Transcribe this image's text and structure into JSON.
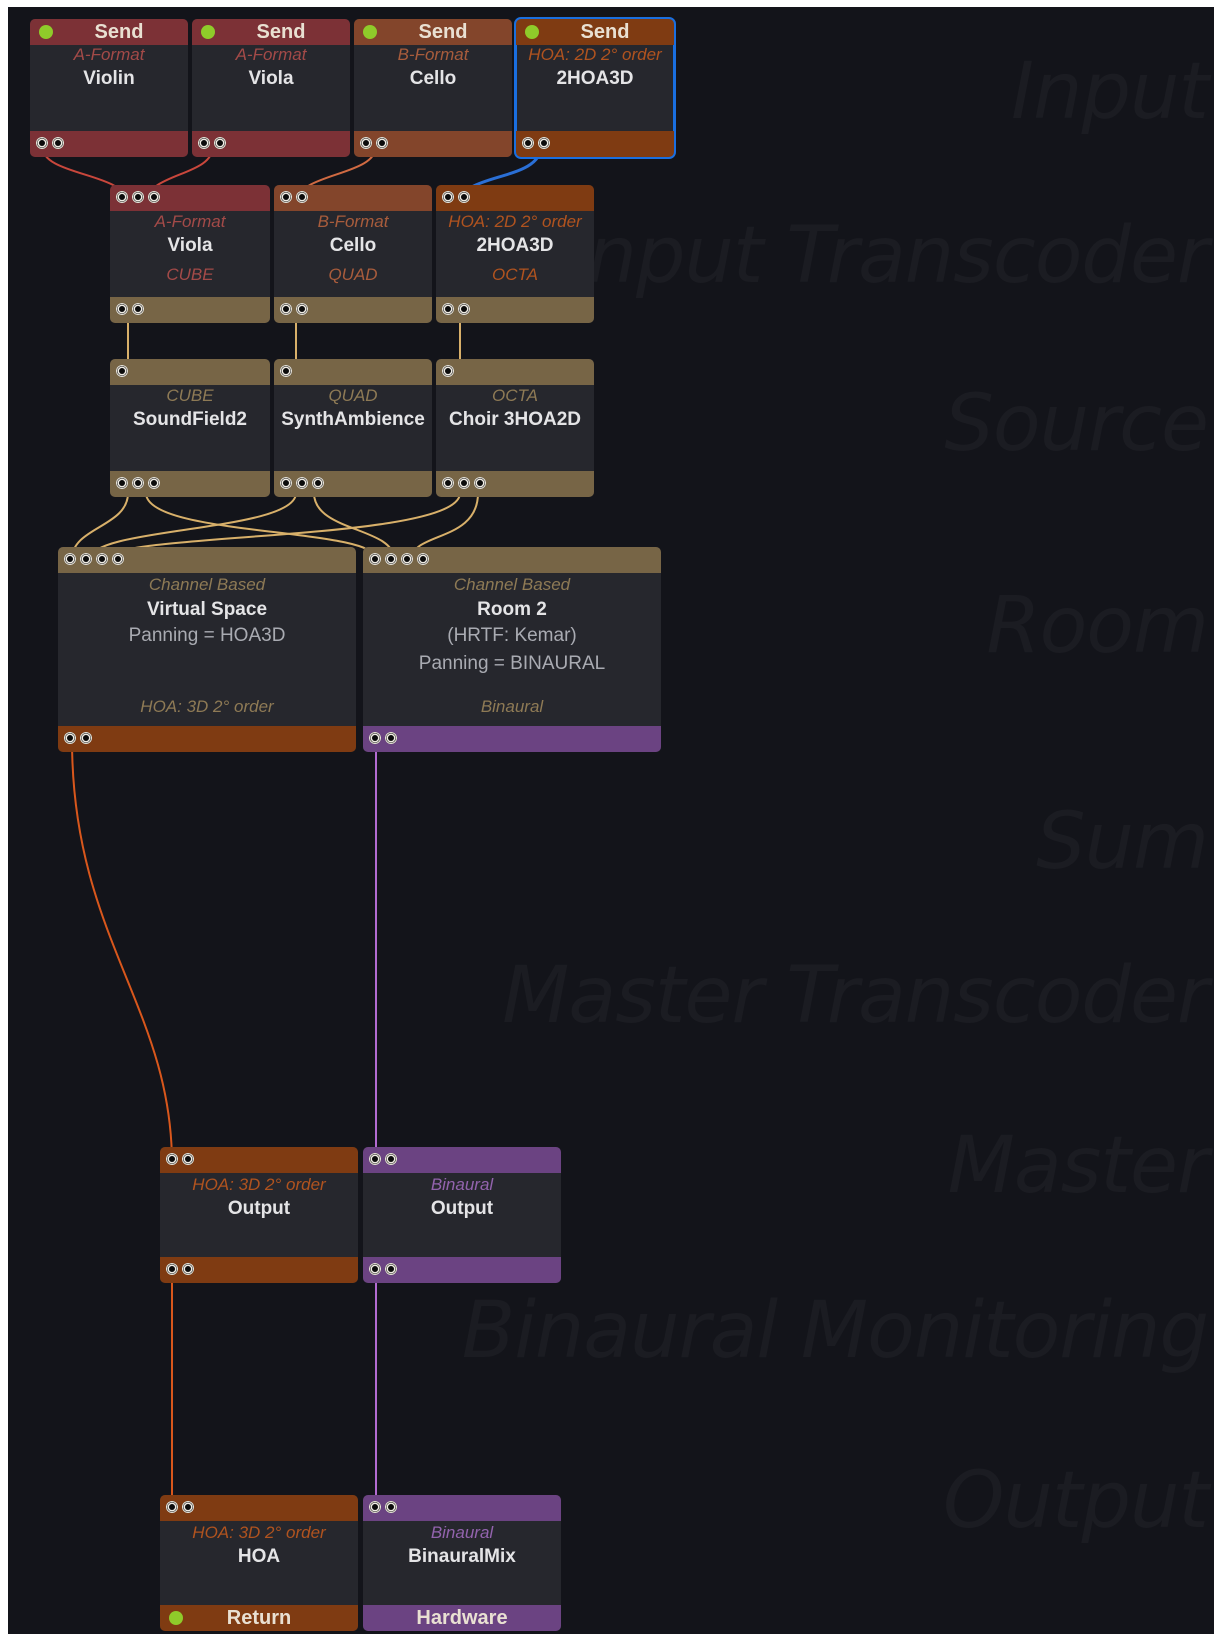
{
  "sections": [
    "Input",
    "Input Transcoder",
    "Source",
    "Room",
    "Sum",
    "Master Transcoder",
    "Master",
    "Binaural Monitoring",
    "Output"
  ],
  "colors": {
    "background": "#13141a",
    "a_format": "#7c3136",
    "b_format": "#83452b",
    "hoa": "#7f3b12",
    "channel": "#776546",
    "binaural": "#6b4382",
    "selection": "#1a6fe0",
    "active_led": "#8fcb2a"
  },
  "icons": [
    "status-led-icon",
    "input-pin-icon",
    "output-pin-icon"
  ],
  "sends": [
    {
      "title": "Send",
      "format": "A-Format",
      "name": "Violin"
    },
    {
      "title": "Send",
      "format": "A-Format",
      "name": "Viola"
    },
    {
      "title": "Send",
      "format": "B-Format",
      "name": "Cello"
    },
    {
      "title": "Send",
      "format": "HOA: 2D 2° order",
      "name": "2HOA3D",
      "selected": true
    }
  ],
  "transcoders": [
    {
      "format": "A-Format",
      "name": "Viola",
      "target": "CUBE"
    },
    {
      "format": "B-Format",
      "name": "Cello",
      "target": "QUAD"
    },
    {
      "format": "HOA: 2D 2° order",
      "name": "2HOA3D",
      "target": "OCTA"
    }
  ],
  "sources": [
    {
      "format": "CUBE",
      "name": "SoundField2"
    },
    {
      "format": "QUAD",
      "name": "SynthAmbience"
    },
    {
      "format": "OCTA",
      "name": "Choir 3HOA2D"
    }
  ],
  "rooms": [
    {
      "format": "Channel Based",
      "name": "Virtual Space",
      "line1": "Panning = HOA3D",
      "line2": "",
      "output": "HOA: 3D 2° order"
    },
    {
      "format": "Channel Based",
      "name": "Room 2",
      "line1": "(HRTF: Kemar)",
      "line2": "Panning = BINAURAL",
      "output": "Binaural"
    }
  ],
  "masters": [
    {
      "format": "HOA: 3D 2° order",
      "name": "Output"
    },
    {
      "format": "Binaural",
      "name": "Output"
    }
  ],
  "outputs": [
    {
      "format": "HOA: 3D 2° order",
      "name": "HOA",
      "footer": "Return"
    },
    {
      "format": "Binaural",
      "name": "BinauralMix",
      "footer": "Hardware"
    }
  ]
}
